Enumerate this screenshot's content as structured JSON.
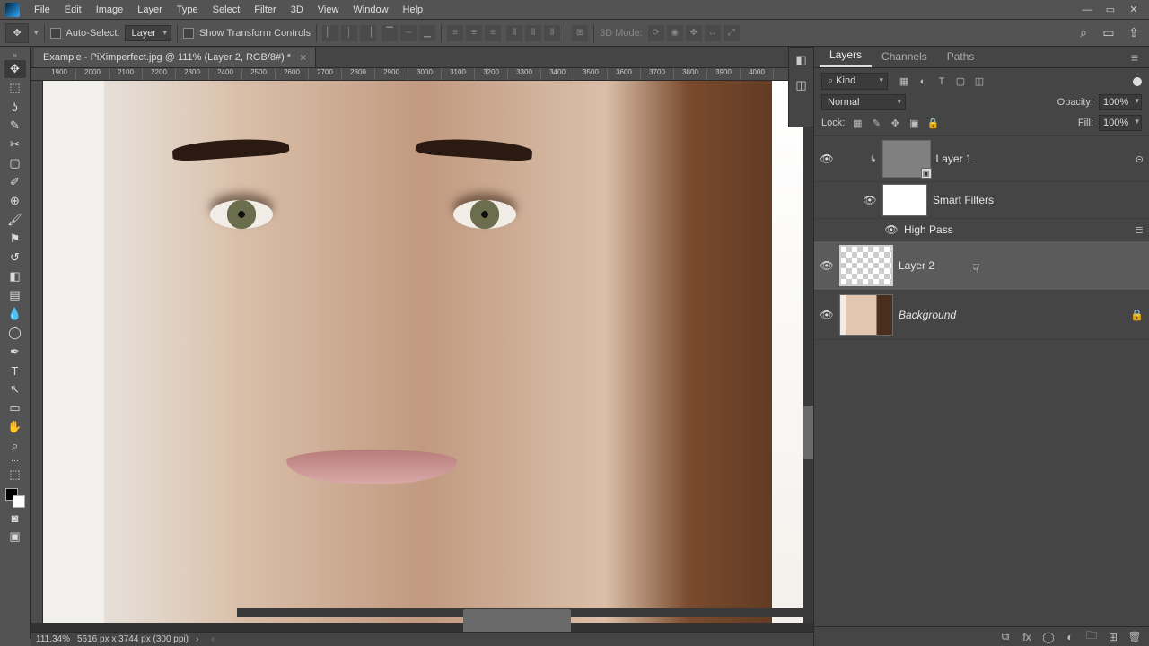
{
  "menubar": [
    "File",
    "Edit",
    "Image",
    "Layer",
    "Type",
    "Select",
    "Filter",
    "3D",
    "View",
    "Window",
    "Help"
  ],
  "options": {
    "auto_select_label": "Auto-Select:",
    "auto_select_target": "Layer",
    "show_transform": "Show Transform Controls",
    "mode3d": "3D Mode:"
  },
  "document": {
    "tab_title": "Example - PiXimperfect.jpg @ 111% (Layer 2, RGB/8#) *",
    "ruler_ticks": [
      "1900",
      "2000",
      "2100",
      "2200",
      "2300",
      "2400",
      "2500",
      "2600",
      "2700",
      "2800",
      "2900",
      "3000",
      "3100",
      "3200",
      "3300",
      "3400",
      "3500",
      "3600",
      "3700",
      "3800",
      "3900",
      "4000"
    ],
    "zoom": "111.34%",
    "dims": "5616 px x 3744 px (300 ppi)"
  },
  "panels": {
    "tabs": {
      "layers": "Layers",
      "channels": "Channels",
      "paths": "Paths"
    },
    "kind": "Kind",
    "blend_mode": "Normal",
    "opacity_label": "Opacity:",
    "opacity_value": "100%",
    "lock_label": "Lock:",
    "fill_label": "Fill:",
    "fill_value": "100%"
  },
  "layers": {
    "layer1": "Layer 1",
    "smart_filters": "Smart Filters",
    "high_pass": "High Pass",
    "layer2": "Layer 2",
    "background": "Background"
  }
}
